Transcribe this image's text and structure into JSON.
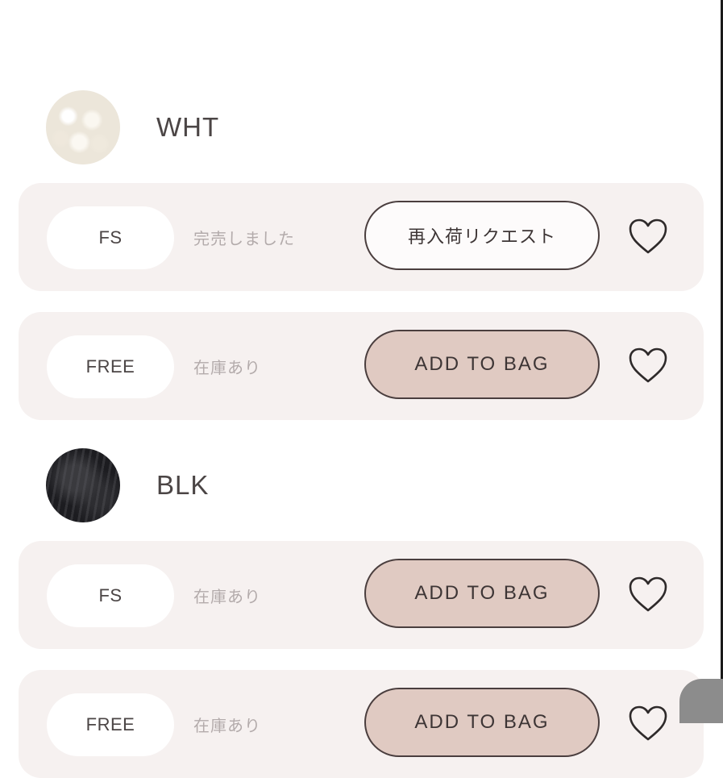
{
  "colors": [
    {
      "name": "WHT",
      "swatch_icon": "white-fabric-swatch",
      "sizes": [
        {
          "size": "FS",
          "status": "完売しました",
          "action": "再入荷リクエスト"
        },
        {
          "size": "FREE",
          "status": "在庫あり",
          "action": "ADD TO BAG"
        }
      ]
    },
    {
      "name": "BLK",
      "swatch_icon": "black-fabric-swatch",
      "sizes": [
        {
          "size": "FS",
          "status": "在庫あり",
          "action": "ADD TO BAG"
        },
        {
          "size": "FREE",
          "status": "在庫あり",
          "action": "ADD TO BAG"
        }
      ]
    }
  ],
  "icons": {
    "favorite": "heart-icon"
  },
  "theme": {
    "row_background": "#f6f1f0",
    "add_button_color": "#e0cac2",
    "border_color": "#4a3e3e",
    "muted_text": "#b3abab"
  }
}
